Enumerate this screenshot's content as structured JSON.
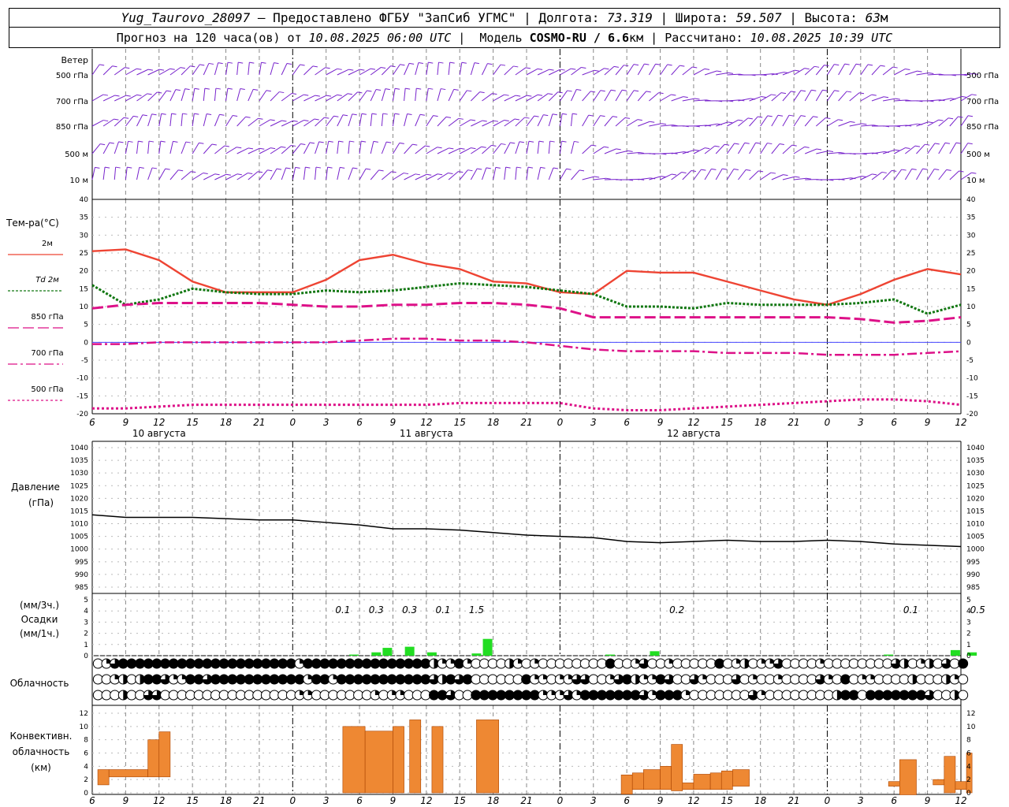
{
  "header": {
    "station": "Yug_Taurovo_28097",
    "provider": " – Предоставлено ФГБУ \"ЗапСиб УГМС\" ",
    "lon_label": " Долгота: ",
    "lon": "73.319",
    "lat_label": " Широта: ",
    "lat": "59.507",
    "alt_label": " Высота: ",
    "alt": "63",
    "alt_unit": "м",
    "forecast_label": "Прогноз на 120 часа(ов) от ",
    "forecast_start": "10.08.2025 06:00 UTC",
    "model_label": "  Модель ",
    "model": "COSMO-RU / 6.6",
    "model_unit": "км",
    "calc_label": " Рассчитано: ",
    "calc_time": "10.08.2025 10:39 UTC"
  },
  "labels": {
    "wind_title": "Ветер",
    "levels": [
      "500 гПа",
      "700 гПа",
      "850 гПа",
      "500 м",
      "10 м"
    ],
    "temp_title": "Тем-ра(°С)",
    "temp_legend": [
      "2м",
      "Td  2м",
      "850 гПа",
      "700 гПа",
      "500 гПа"
    ],
    "pressure_title": "Давление",
    "pressure_unit": "(гПа)",
    "precip_unit1": "(мм/3ч.)",
    "precip_title": "Осадки",
    "precip_unit2": "(мм/1ч.)",
    "cloud_title": "Облачность",
    "conv_title1": "Конвективн.",
    "conv_title2": "облачность",
    "conv_unit": "(км)"
  },
  "colors": {
    "t2m": "#ee4433",
    "td2m": "#117711",
    "t850": "#dd1188",
    "t700": "#dd1188",
    "t500": "#dd1188",
    "wind": "#7722cc",
    "precip": "#22dd22",
    "conv": "#ee8833",
    "pressure": "#000000"
  },
  "chart_data": [
    {
      "type": "line",
      "title": "Тем-ра(°С)",
      "x_ticks": [
        "6",
        "9",
        "12",
        "15",
        "18",
        "21",
        "0",
        "3",
        "6",
        "9",
        "12",
        "15",
        "18",
        "21",
        "0",
        "3",
        "6",
        "9",
        "12",
        "15",
        "18",
        "21",
        "0",
        "3",
        "6",
        "9",
        "12"
      ],
      "days": [
        "10 августа",
        "11 августа",
        "12 августа"
      ],
      "ylim": [
        -20,
        40
      ],
      "y_ticks": [
        40,
        35,
        30,
        25,
        20,
        15,
        10,
        5,
        0,
        -5,
        -10,
        -15,
        -20
      ],
      "x_hours": [
        0,
        3,
        6,
        9,
        12,
        15,
        18,
        21,
        24,
        27,
        30,
        33,
        36,
        39,
        42,
        45,
        48,
        51,
        54,
        57,
        60,
        63,
        66,
        69,
        72,
        75,
        78
      ],
      "series": [
        {
          "name": "2м",
          "values": [
            25.5,
            26,
            23,
            17,
            14,
            14,
            14,
            17.5,
            23,
            24.5,
            22,
            20.5,
            17,
            16.5,
            14,
            13.5,
            20,
            19.5,
            19.5,
            17,
            14.5,
            12,
            10.5,
            13.5,
            17.5,
            20.5,
            19
          ]
        },
        {
          "name": "Td  2м",
          "values": [
            16,
            10.5,
            12,
            15,
            14,
            13.5,
            13.5,
            14.5,
            14,
            14.5,
            15.5,
            16.5,
            16,
            15.5,
            14.5,
            13.5,
            10,
            10,
            9.5,
            11,
            10.5,
            10.5,
            10.5,
            11,
            12,
            8,
            10.5
          ]
        },
        {
          "name": "850 гПа",
          "values": [
            9.5,
            10.5,
            11,
            11,
            11,
            11,
            10.5,
            10,
            10,
            10.5,
            10.5,
            11,
            11,
            10.5,
            9.5,
            7,
            7,
            7,
            7,
            7,
            7,
            7,
            7,
            6.5,
            5.5,
            6,
            7
          ]
        },
        {
          "name": "700 гПа",
          "values": [
            -0.5,
            -0.5,
            0,
            0,
            0,
            0,
            0,
            0,
            0.5,
            1,
            1,
            0.5,
            0.5,
            0,
            -1,
            -2,
            -2.5,
            -2.5,
            -2.5,
            -3,
            -3,
            -3,
            -3.5,
            -3.5,
            -3.5,
            -3,
            -2.5
          ]
        },
        {
          "name": "500 гПа",
          "values": [
            -18.5,
            -18.5,
            -18,
            -17.5,
            -17.5,
            -17.5,
            -17.5,
            -17.5,
            -17.5,
            -17.5,
            -17.5,
            -17,
            -17,
            -17,
            -17,
            -18.5,
            -19,
            -19,
            -18.5,
            -18,
            -17.5,
            -17,
            -16.5,
            -16,
            -16,
            -16.5,
            -17.5
          ]
        }
      ]
    },
    {
      "type": "line",
      "title": "Давление",
      "ylabel": "(гПа)",
      "ylim": [
        985,
        1040
      ],
      "y_ticks": [
        1040,
        1035,
        1030,
        1025,
        1020,
        1015,
        1010,
        1005,
        1000,
        995,
        990,
        985
      ],
      "x_hours": [
        0,
        3,
        6,
        9,
        12,
        15,
        18,
        21,
        24,
        27,
        30,
        33,
        36,
        39,
        42,
        45,
        48,
        51,
        54,
        57,
        60,
        63,
        66,
        69,
        72,
        75,
        78
      ],
      "series": [
        {
          "name": "Давление",
          "values": [
            1013.5,
            1012.5,
            1012.5,
            1012.5,
            1012,
            1011.5,
            1011.5,
            1010.5,
            1009.5,
            1008,
            1008,
            1007.5,
            1006.5,
            1005.5,
            1005,
            1004.5,
            1003,
            1002.5,
            1003,
            1003.5,
            1003,
            1003,
            1003.5,
            1003,
            1002,
            1001.5,
            1001
          ]
        }
      ]
    },
    {
      "type": "bar",
      "title": "Осадки",
      "ylim": [
        0,
        5
      ],
      "y_ticks": [
        5,
        4,
        3,
        2,
        1,
        0
      ],
      "bars": [
        {
          "x": 23.5,
          "value": 0.1
        },
        {
          "x": 25.5,
          "value": 0.3
        },
        {
          "x": 26.5,
          "value": 0.7
        },
        {
          "x": 28.5,
          "value": 0.8
        },
        {
          "x": 30.5,
          "value": 0.3
        },
        {
          "x": 34.5,
          "value": 0.2
        },
        {
          "x": 35.5,
          "value": 1.5
        },
        {
          "x": 46.5,
          "value": 0.1
        },
        {
          "x": 50.5,
          "value": 0.4
        },
        {
          "x": 71.5,
          "value": 0.1
        },
        {
          "x": 77.5,
          "value": 0.5
        },
        {
          "x": 79,
          "value": 0.3
        }
      ],
      "sums": [
        {
          "x": 22.5,
          "text": "0.1"
        },
        {
          "x": 25.5,
          "text": "0.3"
        },
        {
          "x": 28.5,
          "text": "0.3"
        },
        {
          "x": 31.5,
          "text": "0.1"
        },
        {
          "x": 34.5,
          "text": "1.5"
        },
        {
          "x": 52.5,
          "text": "0.2"
        },
        {
          "x": 73.5,
          "text": "0.1"
        },
        {
          "x": 79.5,
          "text": "0.5"
        }
      ]
    },
    {
      "type": "table",
      "title": "Облачность",
      "rows": [
        "01344444444444444444444414444444444444442114100002101000000004001300100000401201130000100000000320120304",
        "00120244311443444444444441441444444444443243400000041101133001342114300310003010010000310401100002000210",
        "00020033000000000000000011000000010110004430044444444111314444444314441000000031000000002440444444430020"
      ]
    },
    {
      "type": "bar",
      "title": "Конвективн. облачность",
      "ylabel": "(км)",
      "ylim": [
        0,
        12
      ],
      "y_ticks": [
        12,
        10,
        8,
        6,
        4,
        2,
        0
      ],
      "bars": [
        {
          "x0": 0.5,
          "x1": 1.5,
          "base": 1.2,
          "top": 3.5
        },
        {
          "x0": 1.5,
          "x1": 5,
          "base": 2.4,
          "top": 3.5
        },
        {
          "x0": 5,
          "x1": 6,
          "base": 2.4,
          "top": 8
        },
        {
          "x0": 6,
          "x1": 7,
          "base": 2.4,
          "top": 9.2
        },
        {
          "x0": 22.5,
          "x1": 24.5,
          "base": 0,
          "top": 10
        },
        {
          "x0": 24.5,
          "x1": 27,
          "base": 0,
          "top": 9.3
        },
        {
          "x0": 27,
          "x1": 28,
          "base": 0,
          "top": 10
        },
        {
          "x0": 28.5,
          "x1": 29.5,
          "base": 0,
          "top": 11
        },
        {
          "x0": 30.5,
          "x1": 31.5,
          "base": 0,
          "top": 10
        },
        {
          "x0": 34.5,
          "x1": 36.5,
          "base": 0,
          "top": 11
        },
        {
          "x0": 47.5,
          "x1": 48.5,
          "base": -0.2,
          "top": 2.7
        },
        {
          "x0": 48.5,
          "x1": 49.5,
          "base": 0.5,
          "top": 3
        },
        {
          "x0": 49.5,
          "x1": 51,
          "base": 0.5,
          "top": 3.5
        },
        {
          "x0": 51,
          "x1": 52,
          "base": 0.5,
          "top": 4
        },
        {
          "x0": 52,
          "x1": 53,
          "base": 0.3,
          "top": 7.3
        },
        {
          "x0": 53,
          "x1": 54,
          "base": 0.5,
          "top": 1.5
        },
        {
          "x0": 54,
          "x1": 55.5,
          "base": 0.5,
          "top": 2.8
        },
        {
          "x0": 55.5,
          "x1": 56.5,
          "base": 0.5,
          "top": 3
        },
        {
          "x0": 56.5,
          "x1": 57.5,
          "base": 0.5,
          "top": 3.3
        },
        {
          "x0": 57.5,
          "x1": 59,
          "base": 1,
          "top": 3.5
        },
        {
          "x0": 71.5,
          "x1": 72.5,
          "base": 1,
          "top": 1.7
        },
        {
          "x0": 72.5,
          "x1": 74,
          "base": -0.3,
          "top": 5
        },
        {
          "x0": 75.5,
          "x1": 76.5,
          "base": 1.2,
          "top": 2
        },
        {
          "x0": 76.5,
          "x1": 77.5,
          "base": 0,
          "top": 5.5
        },
        {
          "x0": 77.5,
          "x1": 78.5,
          "base": 0.5,
          "top": 1.7
        },
        {
          "x0": 78.5,
          "x1": 79,
          "base": 0,
          "top": 6
        }
      ]
    }
  ]
}
